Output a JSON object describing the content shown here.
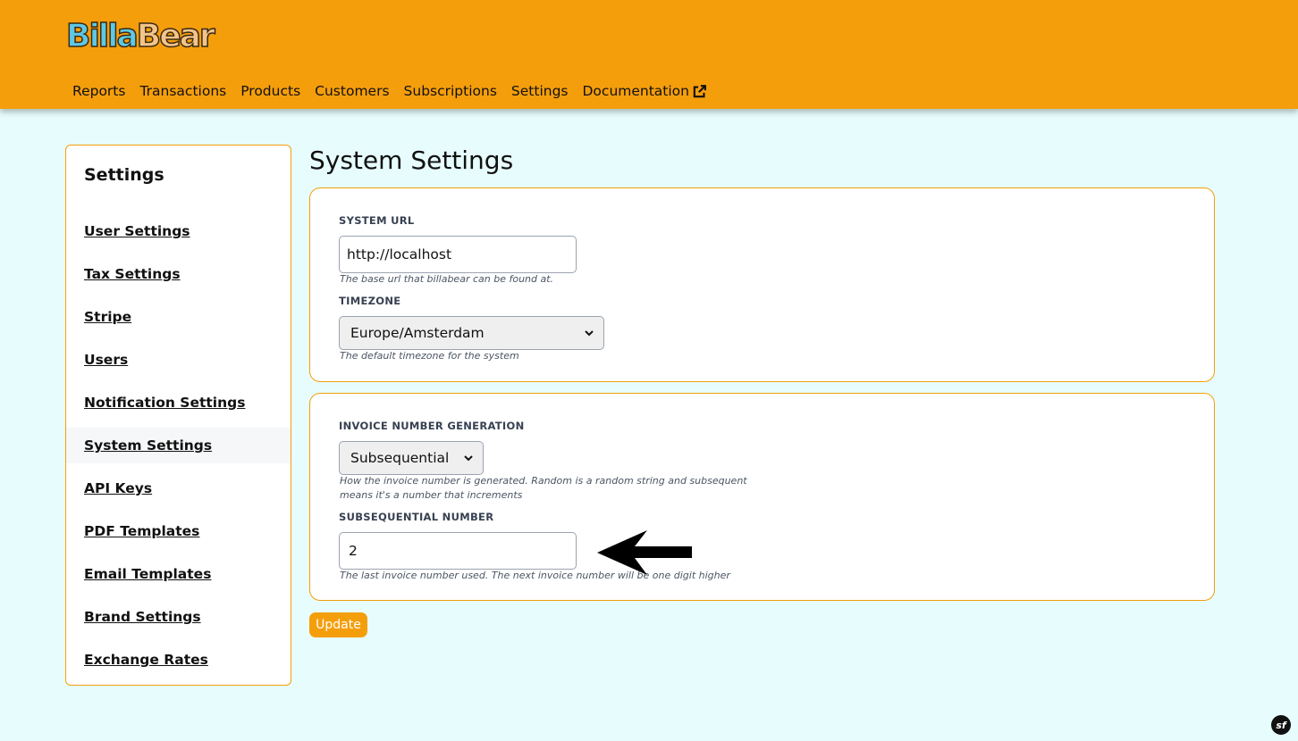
{
  "header": {
    "logo_part1": "Billa",
    "logo_part2": "Bear",
    "nav": [
      "Reports",
      "Transactions",
      "Products",
      "Customers",
      "Subscriptions",
      "Settings",
      "Documentation"
    ]
  },
  "sidebar": {
    "title": "Settings",
    "items": [
      {
        "label": "User Settings"
      },
      {
        "label": "Tax Settings"
      },
      {
        "label": "Stripe"
      },
      {
        "label": "Users"
      },
      {
        "label": "Notification Settings"
      },
      {
        "label": "System Settings",
        "active": true
      },
      {
        "label": "API Keys"
      },
      {
        "label": "PDF Templates"
      },
      {
        "label": "Email Templates"
      },
      {
        "label": "Brand Settings"
      },
      {
        "label": "Exchange Rates"
      }
    ]
  },
  "main": {
    "title": "System Settings",
    "system_url": {
      "label": "SYSTEM URL",
      "value": "http://localhost",
      "help": "The base url that billabear can be found at."
    },
    "timezone": {
      "label": "TIMEZONE",
      "value": "Europe/Amsterdam",
      "help": "The default timezone for the system"
    },
    "invoice_generation": {
      "label": "INVOICE NUMBER GENERATION",
      "value": "Subsequential",
      "help_line1": "How the invoice number is generated. Random is a random string and subsequent",
      "help_line2": "means it's a number that increments"
    },
    "subsequential_number": {
      "label": "SUBSEQUENTIAL NUMBER",
      "value": "2",
      "help": "The last invoice number used. The next invoice number will be one digit higher"
    },
    "update_label": "Update"
  },
  "icons": {
    "external_link": "external-link-icon",
    "arrow": "arrow-left-icon",
    "framework_badge": "symfony-icon"
  },
  "badge_text": "sf",
  "colors": {
    "accent": "#f59e0b",
    "background": "#e7fdfd"
  }
}
